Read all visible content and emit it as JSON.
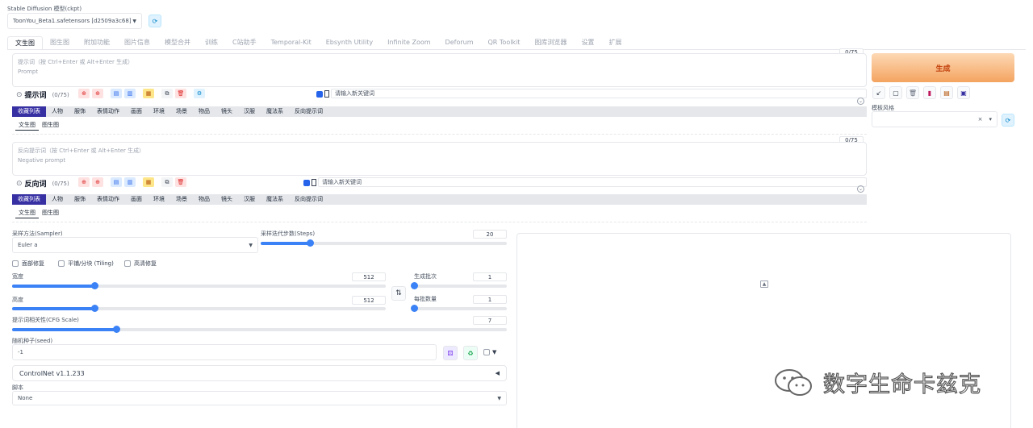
{
  "model": {
    "label": "Stable Diffusion 模型(ckpt)",
    "value": "ToonYou_Beta1.safetensors [d2509a3c68]"
  },
  "tabs": [
    "文生图",
    "图生图",
    "附加功能",
    "图片信息",
    "模型合并",
    "训练",
    "C站助手",
    "Temporal-Kit",
    "Ebsynth Utility",
    "Infinite Zoom",
    "Deforum",
    "QR Toolkit",
    "图库浏览器",
    "设置",
    "扩展"
  ],
  "prompt": {
    "counter": "0/75",
    "placeholder_cn": "提示词（按 Ctrl+Enter 或 Alt+Enter 生成）",
    "placeholder_en": "Prompt",
    "section_title": "提示词",
    "section_count": "(0/75)",
    "keyword_placeholder": "请输入新关键词"
  },
  "neg_prompt": {
    "counter": "0/75",
    "placeholder_cn": "反向提示词（按 Ctrl+Enter 或 Alt+Enter 生成）",
    "placeholder_en": "Negative prompt",
    "section_title": "反向词",
    "section_count": "(0/75)",
    "keyword_placeholder": "请输入新关键词"
  },
  "categories": [
    "收藏列表",
    "人物",
    "服饰",
    "表情动作",
    "画面",
    "环境",
    "场景",
    "物品",
    "镜头",
    "汉服",
    "魔法系",
    "反向提示词"
  ],
  "subtabs": [
    "文生图",
    "图生图"
  ],
  "generate": {
    "label": "生成"
  },
  "template": {
    "label": "模板风格",
    "clear": "×",
    "arrow": "▾"
  },
  "sampler": {
    "label": "采样方法(Sampler)",
    "value": "Euler a"
  },
  "steps": {
    "label": "采样迭代步数(Steps)",
    "value": "20",
    "fraction": 0.2
  },
  "options": [
    "面部修复",
    "平铺/分块 (Tiling)",
    "高清修复"
  ],
  "width": {
    "label": "宽度",
    "value": "512",
    "fraction": 0.22
  },
  "height": {
    "label": "高度",
    "value": "512",
    "fraction": 0.22
  },
  "batch_count": {
    "label": "生成批次",
    "value": "1",
    "fraction": 0.0
  },
  "batch_size": {
    "label": "每批数量",
    "value": "1",
    "fraction": 0.0
  },
  "cfg": {
    "label": "提示词相关性(CFG Scale)",
    "value": "7",
    "fraction": 0.21
  },
  "seed": {
    "label": "随机种子(seed)",
    "value": "-1"
  },
  "controlnet": {
    "label": "ControlNet v1.1.233",
    "arrow": "◀"
  },
  "script": {
    "label": "脚本",
    "value": "None"
  },
  "watermark": {
    "text": "数字生命卡兹克"
  },
  "colors": {
    "accent": "#3b82f6",
    "generate": "#f4a460",
    "category_active": "#3730a3"
  }
}
